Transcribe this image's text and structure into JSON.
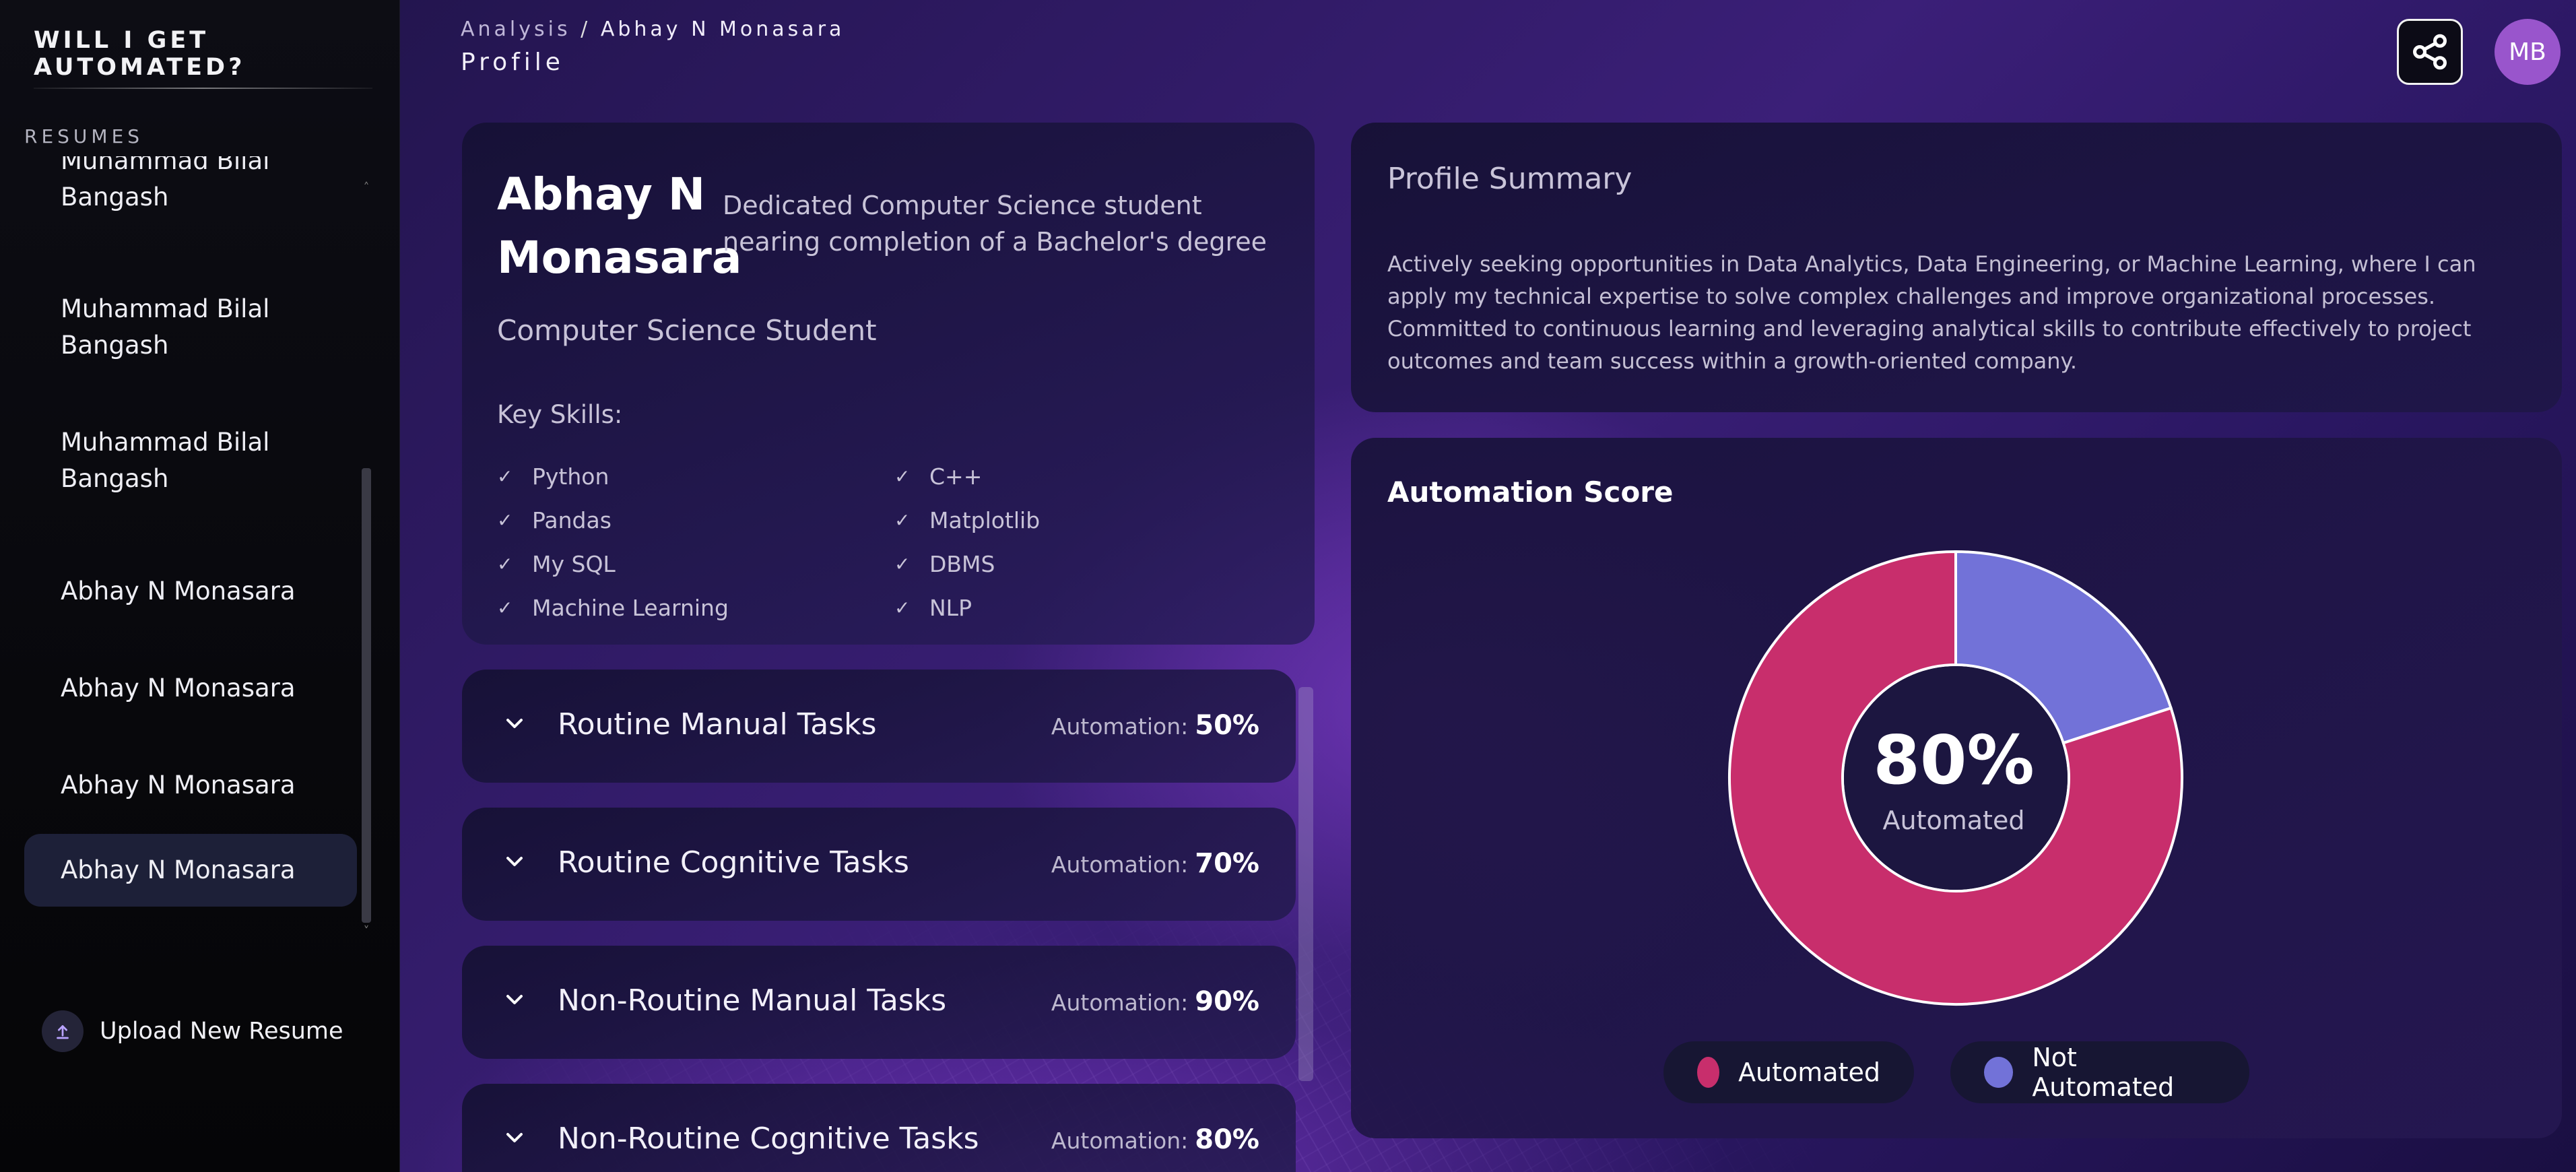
{
  "app": {
    "title": "WILL I GET AUTOMATED?"
  },
  "sidebar": {
    "section_label": "RESUMES",
    "items": [
      {
        "label": "Muhammad Bilal Bangash",
        "active": false
      },
      {
        "label": "Muhammad Bilal Bangash",
        "active": false
      },
      {
        "label": "Muhammad Bilal Bangash",
        "active": false
      },
      {
        "label": "Abhay N Monasara",
        "active": false
      },
      {
        "label": "Abhay N Monasara",
        "active": false
      },
      {
        "label": "Abhay N Monasara",
        "active": false
      },
      {
        "label": "Abhay N Monasara",
        "active": true
      }
    ],
    "upload_label": "Upload New Resume"
  },
  "header": {
    "breadcrumb_parent": "Analysis",
    "breadcrumb_separator": "/",
    "breadcrumb_current": "Abhay N Monasara",
    "page_title": "Profile",
    "avatar_initials": "MB"
  },
  "profile": {
    "name": "Abhay N Monasara",
    "tagline": "Dedicated Computer Science student nearing completion of a Bachelor's degree",
    "role": "Computer Science Student",
    "skills_label": "Key Skills:",
    "skills": [
      "Python",
      "C++",
      "Pandas",
      "Matplotlib",
      "My SQL",
      "DBMS",
      "Machine Learning",
      "NLP"
    ]
  },
  "tasks": {
    "automation_label": "Automation:",
    "items": [
      {
        "name": "Routine Manual Tasks",
        "value": "50%"
      },
      {
        "name": "Routine Cognitive Tasks",
        "value": "70%"
      },
      {
        "name": "Non-Routine Manual Tasks",
        "value": "90%"
      },
      {
        "name": "Non-Routine Cognitive Tasks",
        "value": "80%"
      }
    ]
  },
  "summary": {
    "title": "Profile Summary",
    "text": "Actively seeking opportunities in Data Analytics, Data Engineering, or Machine Learning, where I can apply my technical expertise to solve complex challenges and improve organizational processes. Committed to continuous learning and leveraging analytical skills to contribute effectively to project outcomes and team success within a growth-oriented company."
  },
  "score": {
    "title": "Automation Score",
    "value_label": "80%",
    "sub_label": "Automated"
  },
  "chart_data": {
    "type": "pie",
    "categories": [
      "Automated",
      "Not Automated"
    ],
    "values": [
      80,
      20
    ],
    "colors": [
      "#c82e6c",
      "#7272d8"
    ],
    "legend_position": "bottom"
  },
  "colors": {
    "accent_purple": "#9955cc",
    "automated": "#c82e6c",
    "not_automated": "#7272d8"
  }
}
